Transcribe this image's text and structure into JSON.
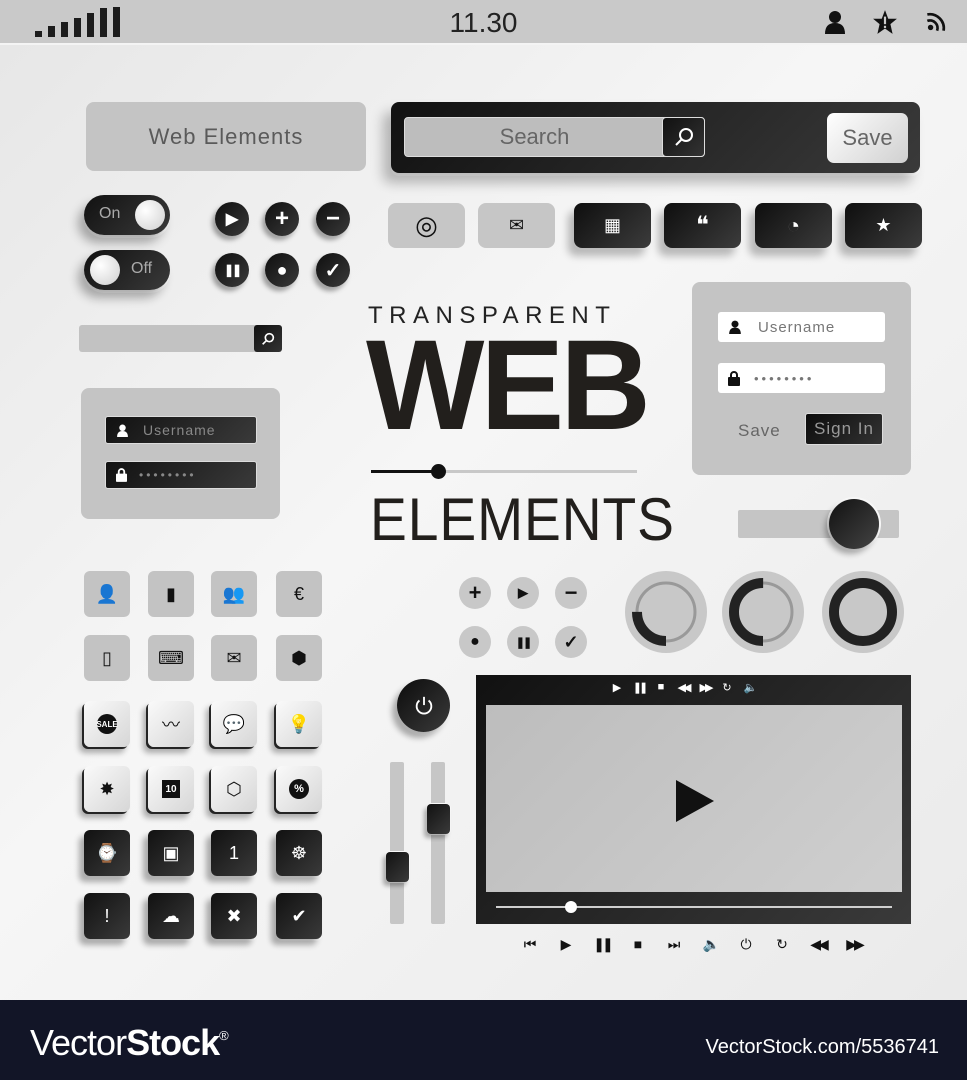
{
  "statusbar": {
    "signal_icon": "signal-bars-icon",
    "time": "11.30",
    "icons": [
      "user-icon",
      "star-alert-icon",
      "wifi-icon"
    ]
  },
  "header_panel": {
    "label": "Web Elements"
  },
  "search_bar": {
    "placeholder": "Search",
    "search_icon": "magnifier-icon",
    "save_label": "Save"
  },
  "toggles": [
    {
      "label": "On",
      "state": "on"
    },
    {
      "label": "Off",
      "state": "off"
    }
  ],
  "round_buttons_dark": [
    {
      "icon": "play-icon",
      "glyph": "▶"
    },
    {
      "icon": "plus-icon",
      "glyph": "+"
    },
    {
      "icon": "minus-icon",
      "glyph": "−"
    },
    {
      "icon": "pause-icon",
      "glyph": "❚❚"
    },
    {
      "icon": "record-icon",
      "glyph": "●"
    },
    {
      "icon": "check-icon",
      "glyph": "✓"
    }
  ],
  "toolbar_buttons": [
    {
      "icon": "target-icon",
      "glyph": "◎",
      "style": "light"
    },
    {
      "icon": "mail-icon",
      "glyph": "✉",
      "style": "light"
    },
    {
      "icon": "globe-grid-icon",
      "glyph": "▦",
      "style": "dark"
    },
    {
      "icon": "chat-bubbles-icon",
      "glyph": "❝",
      "style": "dark"
    },
    {
      "icon": "pie-chart-icon",
      "glyph": "◔",
      "style": "dark"
    },
    {
      "icon": "star-alert-icon",
      "glyph": "★",
      "style": "dark"
    }
  ],
  "small_search": {
    "placeholder": "",
    "search_icon": "magnifier-icon"
  },
  "title": {
    "line1": "TRANSPARENT",
    "line2": "WEB",
    "line3": "ELEMENTS",
    "slider_value": 0.25
  },
  "login_light": {
    "username_placeholder": "Username",
    "password_mask": "••••••••",
    "save_label": "Save",
    "signin_label": "Sign In"
  },
  "login_dark": {
    "username_placeholder": "Username",
    "password_mask": "••••••••"
  },
  "h_slider": {
    "value": 0.72
  },
  "icon_tiles": [
    [
      {
        "icon": "user-icon",
        "glyph": "👤",
        "style": "gray"
      },
      {
        "icon": "bar-chart-icon",
        "glyph": "▮",
        "style": "gray"
      },
      {
        "icon": "group-icon",
        "glyph": "👥",
        "style": "gray"
      },
      {
        "icon": "euro-icon",
        "glyph": "€",
        "style": "gray"
      }
    ],
    [
      {
        "icon": "phone-icon",
        "glyph": "▯",
        "style": "gray"
      },
      {
        "icon": "laptop-icon",
        "glyph": "⌨",
        "style": "gray"
      },
      {
        "icon": "envelope-icon",
        "glyph": "✉",
        "style": "gray"
      },
      {
        "icon": "hexagon-up-icon",
        "glyph": "⬢",
        "style": "gray"
      }
    ],
    [
      {
        "icon": "sale-badge-icon",
        "glyph": "SALE",
        "style": "white"
      },
      {
        "icon": "trend-line-icon",
        "glyph": "〰",
        "style": "white"
      },
      {
        "icon": "chat-icon",
        "glyph": "💬",
        "style": "white"
      },
      {
        "icon": "lightbulb-icon",
        "glyph": "💡",
        "style": "white"
      }
    ],
    [
      {
        "icon": "badge-star-icon",
        "glyph": "✸",
        "style": "white"
      },
      {
        "icon": "calendar-icon",
        "glyph": "10",
        "style": "white"
      },
      {
        "icon": "cube-icon",
        "glyph": "⬡",
        "style": "white"
      },
      {
        "icon": "percent-icon",
        "glyph": "%",
        "style": "white"
      }
    ],
    [
      {
        "icon": "watch-icon",
        "glyph": "⌚",
        "style": "dark"
      },
      {
        "icon": "camera-icon",
        "glyph": "▣",
        "style": "dark"
      },
      {
        "icon": "bookmark-icon",
        "glyph": "1",
        "style": "dark"
      },
      {
        "icon": "steering-wheel-icon",
        "glyph": "☸",
        "style": "dark"
      }
    ],
    [
      {
        "icon": "alert-bubble-icon",
        "glyph": "!",
        "style": "dark"
      },
      {
        "icon": "rain-cloud-icon",
        "glyph": "☁",
        "style": "dark"
      },
      {
        "icon": "remove-user-icon",
        "glyph": "✖",
        "style": "dark"
      },
      {
        "icon": "approve-user-icon",
        "glyph": "✔",
        "style": "dark"
      }
    ]
  ],
  "round_buttons_light": [
    {
      "icon": "plus-icon",
      "glyph": "+"
    },
    {
      "icon": "play-icon",
      "glyph": "▶"
    },
    {
      "icon": "minus-icon",
      "glyph": "−"
    },
    {
      "icon": "record-icon",
      "glyph": "●"
    },
    {
      "icon": "pause-icon",
      "glyph": "❚❚"
    },
    {
      "icon": "check-icon",
      "glyph": "✓"
    }
  ],
  "progress_rings": [
    {
      "value": 0.25
    },
    {
      "value": 0.5
    },
    {
      "value": 1.0
    }
  ],
  "power_button": {
    "icon": "power-icon",
    "glyph": "⏻"
  },
  "v_sliders": [
    {
      "value": 0.35
    },
    {
      "value": 0.65
    }
  ],
  "video_player": {
    "top_controls": [
      {
        "icon": "play-icon",
        "glyph": "▶"
      },
      {
        "icon": "pause-icon",
        "glyph": "❚❚"
      },
      {
        "icon": "stop-icon",
        "glyph": "■"
      },
      {
        "icon": "rewind-icon",
        "glyph": "◀◀"
      },
      {
        "icon": "fast-forward-icon",
        "glyph": "▶▶"
      },
      {
        "icon": "repeat-icon",
        "glyph": "↻"
      },
      {
        "icon": "volume-icon",
        "glyph": "🔈"
      }
    ],
    "center_play_icon": "play-icon",
    "progress": 0.19,
    "bottom_controls": [
      {
        "icon": "skip-previous-icon",
        "glyph": "⏮"
      },
      {
        "icon": "play-icon",
        "glyph": "▶"
      },
      {
        "icon": "pause-icon",
        "glyph": "❚❚"
      },
      {
        "icon": "stop-icon",
        "glyph": "■"
      },
      {
        "icon": "skip-next-icon",
        "glyph": "⏭"
      },
      {
        "icon": "volume-icon",
        "glyph": "🔈"
      },
      {
        "icon": "power-icon",
        "glyph": "⏻"
      },
      {
        "icon": "repeat-icon",
        "glyph": "↻"
      },
      {
        "icon": "rewind-icon",
        "glyph": "◀◀"
      },
      {
        "icon": "fast-forward-icon",
        "glyph": "▶▶"
      }
    ]
  },
  "footer": {
    "brand_light": "Vector",
    "brand_bold": "Stock",
    "registered": "®",
    "image_ref": "VectorStock.com/5536741"
  }
}
